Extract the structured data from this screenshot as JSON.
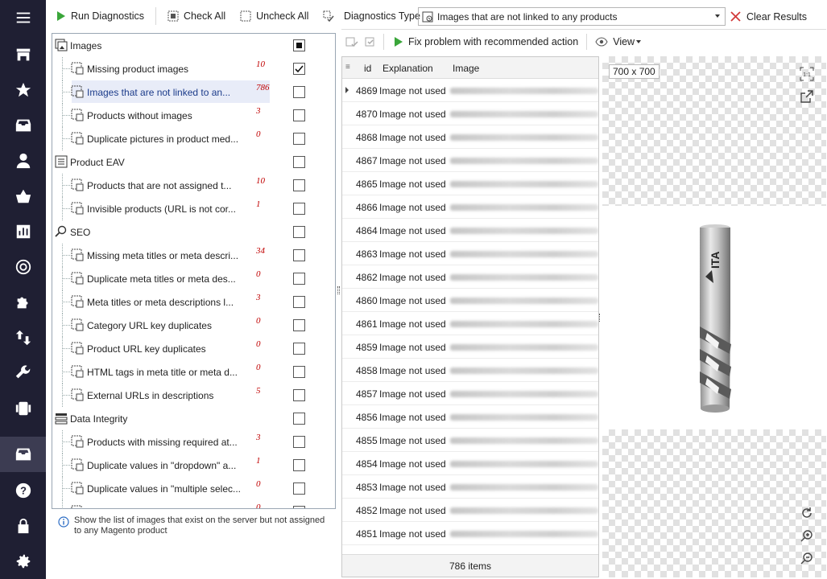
{
  "toolbar": {
    "run_label": "Run Diagnostics",
    "check_all_label": "Check All",
    "uncheck_all_label": "Uncheck All"
  },
  "tree": [
    {
      "label": "Images",
      "count": "",
      "level": 0,
      "checked": "filled",
      "icon": "images-group-icon"
    },
    {
      "label": "Missing product images",
      "count": "10",
      "level": 1,
      "checked": "check",
      "icon": "image-warning-icon"
    },
    {
      "label": "Images that are not linked to an...",
      "count": "786",
      "level": 1,
      "checked": "none",
      "icon": "image-unlinked-icon",
      "selected": true
    },
    {
      "label": "Products without images",
      "count": "3",
      "level": 1,
      "checked": "none",
      "icon": "image-missing-icon"
    },
    {
      "label": "Duplicate pictures in product med...",
      "count": "0",
      "level": 1,
      "checked": "none",
      "icon": "image-duplicate-icon"
    },
    {
      "label": "Product EAV",
      "count": "",
      "level": 0,
      "checked": "none",
      "icon": "eav-group-icon"
    },
    {
      "label": "Products that are not assigned t...",
      "count": "10",
      "level": 1,
      "checked": "none",
      "icon": "product-unassigned-icon"
    },
    {
      "label": "Invisible products (URL is not cor...",
      "count": "1",
      "level": 1,
      "checked": "none",
      "icon": "invisible-product-icon"
    },
    {
      "label": "SEO",
      "count": "",
      "level": 0,
      "checked": "none",
      "icon": "seo-group-icon"
    },
    {
      "label": "Missing meta titles or meta descri...",
      "count": "34",
      "level": 1,
      "checked": "none",
      "icon": "meta-missing-icon"
    },
    {
      "label": "Duplicate meta titles or meta des...",
      "count": "0",
      "level": 1,
      "checked": "none",
      "icon": "meta-duplicate-icon"
    },
    {
      "label": "Meta titles or meta descriptions l...",
      "count": "3",
      "level": 1,
      "checked": "none",
      "icon": "meta-length-icon"
    },
    {
      "label": "Category URL key duplicates",
      "count": "0",
      "level": 1,
      "checked": "none",
      "icon": "category-url-icon"
    },
    {
      "label": "Product URL key duplicates",
      "count": "0",
      "level": 1,
      "checked": "none",
      "icon": "product-url-icon"
    },
    {
      "label": "HTML tags in meta title or meta d...",
      "count": "0",
      "level": 1,
      "checked": "none",
      "icon": "html-tags-icon"
    },
    {
      "label": "External URLs in descriptions",
      "count": "5",
      "level": 1,
      "checked": "none",
      "icon": "external-url-icon"
    },
    {
      "label": "Data Integrity",
      "count": "",
      "level": 0,
      "checked": "none",
      "icon": "integrity-group-icon"
    },
    {
      "label": "Products with missing required at...",
      "count": "3",
      "level": 1,
      "checked": "none",
      "icon": "required-attr-icon"
    },
    {
      "label": "Duplicate values in \"dropdown\" a...",
      "count": "1",
      "level": 1,
      "checked": "none",
      "icon": "dropdown-dup-icon"
    },
    {
      "label": "Duplicate values in \"multiple selec...",
      "count": "0",
      "level": 1,
      "checked": "none",
      "icon": "multiselect-dup-icon"
    },
    {
      "label": "",
      "count": "0",
      "level": 1,
      "checked": "none",
      "icon": "partial-row-icon"
    }
  ],
  "hint": "Show the list of images that exist on the server but not assigned to any Magento product",
  "diagnostics_type": {
    "label": "Diagnostics Type",
    "value": "Images that are not linked to any products"
  },
  "clear_label": "Clear Results",
  "fix_label": "Fix problem with recommended action",
  "view_label": "View",
  "grid": {
    "columns": [
      "id",
      "Explanation",
      "Image"
    ],
    "rows": [
      {
        "id": "4869",
        "explanation": "Image not used"
      },
      {
        "id": "4870",
        "explanation": "Image not used"
      },
      {
        "id": "4868",
        "explanation": "Image not used"
      },
      {
        "id": "4867",
        "explanation": "Image not used"
      },
      {
        "id": "4865",
        "explanation": "Image not used"
      },
      {
        "id": "4866",
        "explanation": "Image not used"
      },
      {
        "id": "4864",
        "explanation": "Image not used"
      },
      {
        "id": "4863",
        "explanation": "Image not used"
      },
      {
        "id": "4862",
        "explanation": "Image not used"
      },
      {
        "id": "4860",
        "explanation": "Image not used"
      },
      {
        "id": "4861",
        "explanation": "Image not used"
      },
      {
        "id": "4859",
        "explanation": "Image not used"
      },
      {
        "id": "4858",
        "explanation": "Image not used"
      },
      {
        "id": "4857",
        "explanation": "Image not used"
      },
      {
        "id": "4856",
        "explanation": "Image not used"
      },
      {
        "id": "4855",
        "explanation": "Image not used"
      },
      {
        "id": "4854",
        "explanation": "Image not used"
      },
      {
        "id": "4853",
        "explanation": "Image not used"
      },
      {
        "id": "4852",
        "explanation": "Image not used"
      },
      {
        "id": "4851",
        "explanation": "Image not used"
      }
    ],
    "footer": "786 items"
  },
  "preview": {
    "dimensions": "700 x 700",
    "product_brand": "ITA"
  },
  "sidebar_icons": [
    "menu-icon",
    "store-icon",
    "star-icon",
    "archive-icon",
    "user-icon",
    "basket-icon",
    "chart-icon",
    "openai-icon",
    "puzzle-icon",
    "transfer-icon",
    "wrench-icon",
    "plugin-icon",
    "diagnostics-icon",
    "help-icon",
    "lock-icon",
    "settings-icon"
  ]
}
